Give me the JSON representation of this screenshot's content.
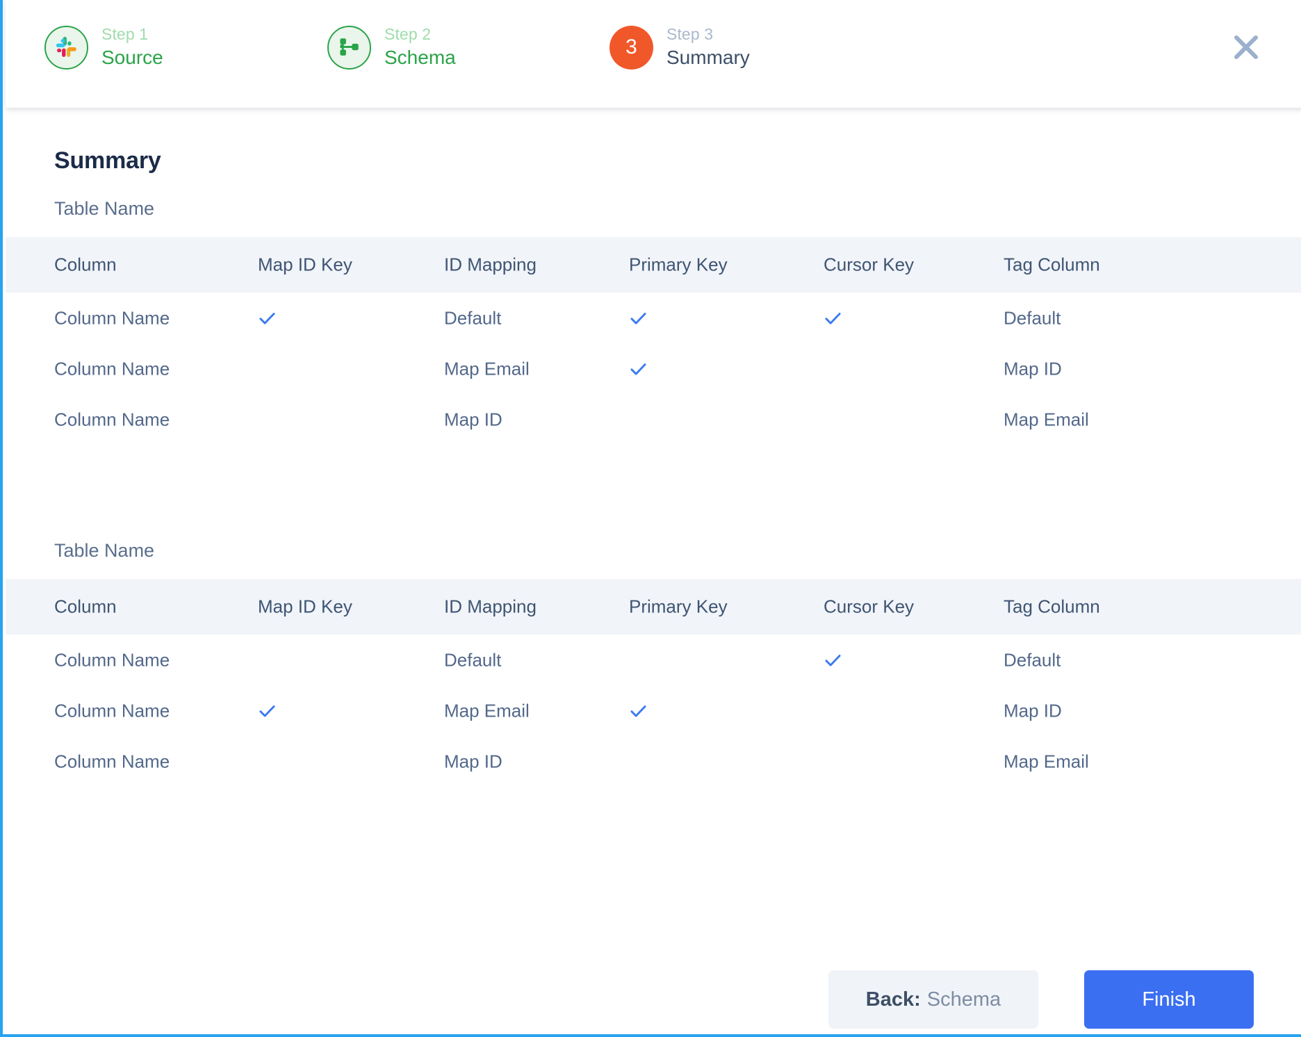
{
  "stepper": {
    "steps": [
      {
        "kicker": "Step 1",
        "label": "Source",
        "icon": "slack-logo-icon",
        "state": "done"
      },
      {
        "kicker": "Step 2",
        "label": "Schema",
        "icon": "schema-tree-icon",
        "state": "done"
      },
      {
        "kicker": "Step 3",
        "label": "Summary",
        "icon": "step-number-3",
        "badge": "3",
        "state": "active"
      }
    ],
    "close_icon": "close-icon"
  },
  "main": {
    "title": "Summary",
    "columns": [
      "Column",
      "Map ID Key",
      "ID Mapping",
      "Primary Key",
      "Cursor Key",
      "Tag Column"
    ],
    "tables": [
      {
        "name": "Table Name",
        "rows": [
          {
            "column": "Column Name",
            "map_id_key": true,
            "id_mapping": "Default",
            "primary_key": true,
            "cursor_key": true,
            "tag_column": "Default"
          },
          {
            "column": "Column Name",
            "map_id_key": false,
            "id_mapping": "Map Email",
            "primary_key": true,
            "cursor_key": false,
            "tag_column": "Map ID"
          },
          {
            "column": "Column Name",
            "map_id_key": false,
            "id_mapping": "Map ID",
            "primary_key": false,
            "cursor_key": false,
            "tag_column": "Map Email"
          }
        ]
      },
      {
        "name": "Table Name",
        "rows": [
          {
            "column": "Column Name",
            "map_id_key": false,
            "id_mapping": "Default",
            "primary_key": false,
            "cursor_key": true,
            "tag_column": "Default"
          },
          {
            "column": "Column Name",
            "map_id_key": true,
            "id_mapping": "Map Email",
            "primary_key": true,
            "cursor_key": false,
            "tag_column": "Map ID"
          },
          {
            "column": "Column Name",
            "map_id_key": false,
            "id_mapping": "Map ID",
            "primary_key": false,
            "cursor_key": false,
            "tag_column": "Map Email"
          }
        ]
      }
    ]
  },
  "footer": {
    "back_prefix": "Back:",
    "back_target": "Schema",
    "finish_label": "Finish"
  },
  "colors": {
    "accent_blue": "#3b6ff2",
    "check_blue": "#3b7bf0",
    "step_done_green": "#2aa448",
    "step_active_orange": "#f0582a",
    "title_navy": "#1b2b48",
    "text_slate": "#53688a",
    "header_band": "#f1f4f9",
    "frame_blue": "#27a3f0"
  }
}
